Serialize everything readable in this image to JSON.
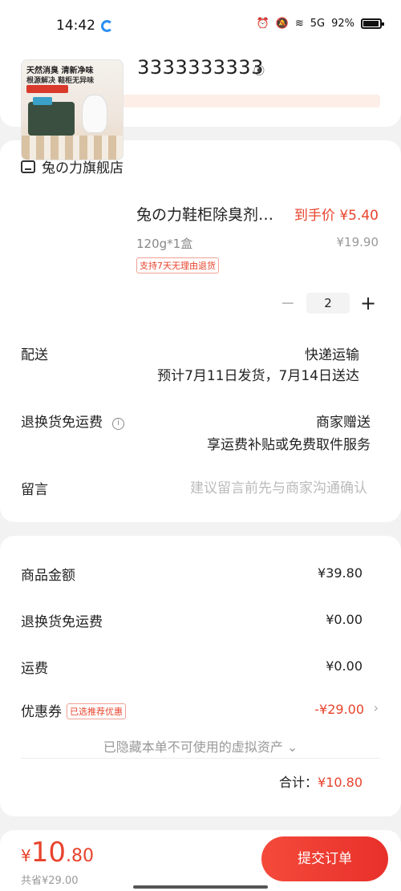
{
  "status_bar": {
    "time": "14:42",
    "network": "5G",
    "battery": "92%"
  },
  "header": {
    "back_icon": "chevron-left",
    "phone": "3333333333",
    "location_icon": "map-pin"
  },
  "shop": {
    "name": "兔の力旗舰店"
  },
  "product": {
    "title": "兔の力鞋柜除臭剂…",
    "price": "到手价 ¥5.40",
    "spec": "120g*1盒",
    "original_price": "¥19.90",
    "badge": "支持7天无理由退货",
    "quantity": "2",
    "image_text_1": "天然消臭 清新净味",
    "image_text_2": "根源解决 鞋柜无异味"
  },
  "delivery": {
    "label": "配送",
    "method": "快递运输",
    "estimate": "预计7月11日发货，7月14日送达"
  },
  "return_shipping": {
    "label": "退换货免运费",
    "value": "商家赠送",
    "detail": "享运费补贴或免费取件服务"
  },
  "message": {
    "label": "留言",
    "placeholder": "建议留言前先与商家沟通确认"
  },
  "summary": {
    "goods_label": "商品金额",
    "goods_value": "¥39.80",
    "return_label": "退换货免运费",
    "return_value": "¥0.00",
    "shipping_label": "运费",
    "shipping_value": "¥0.00",
    "coupon_label": "优惠券",
    "coupon_tag": "已选推荐优惠",
    "coupon_value": "-¥29.00",
    "hidden_assets": "已隐藏本单不可使用的虚拟资产 ⌄",
    "total_label": "合计：",
    "total_value": "¥10.80"
  },
  "bottom": {
    "currency": "¥",
    "price_int": "10",
    "price_dec": ".80",
    "saved": "共省¥29.00",
    "submit_label": "提交订单"
  },
  "colors": {
    "accent": "#e8432c",
    "background": "#f2f2f2",
    "card": "#ffffff"
  }
}
